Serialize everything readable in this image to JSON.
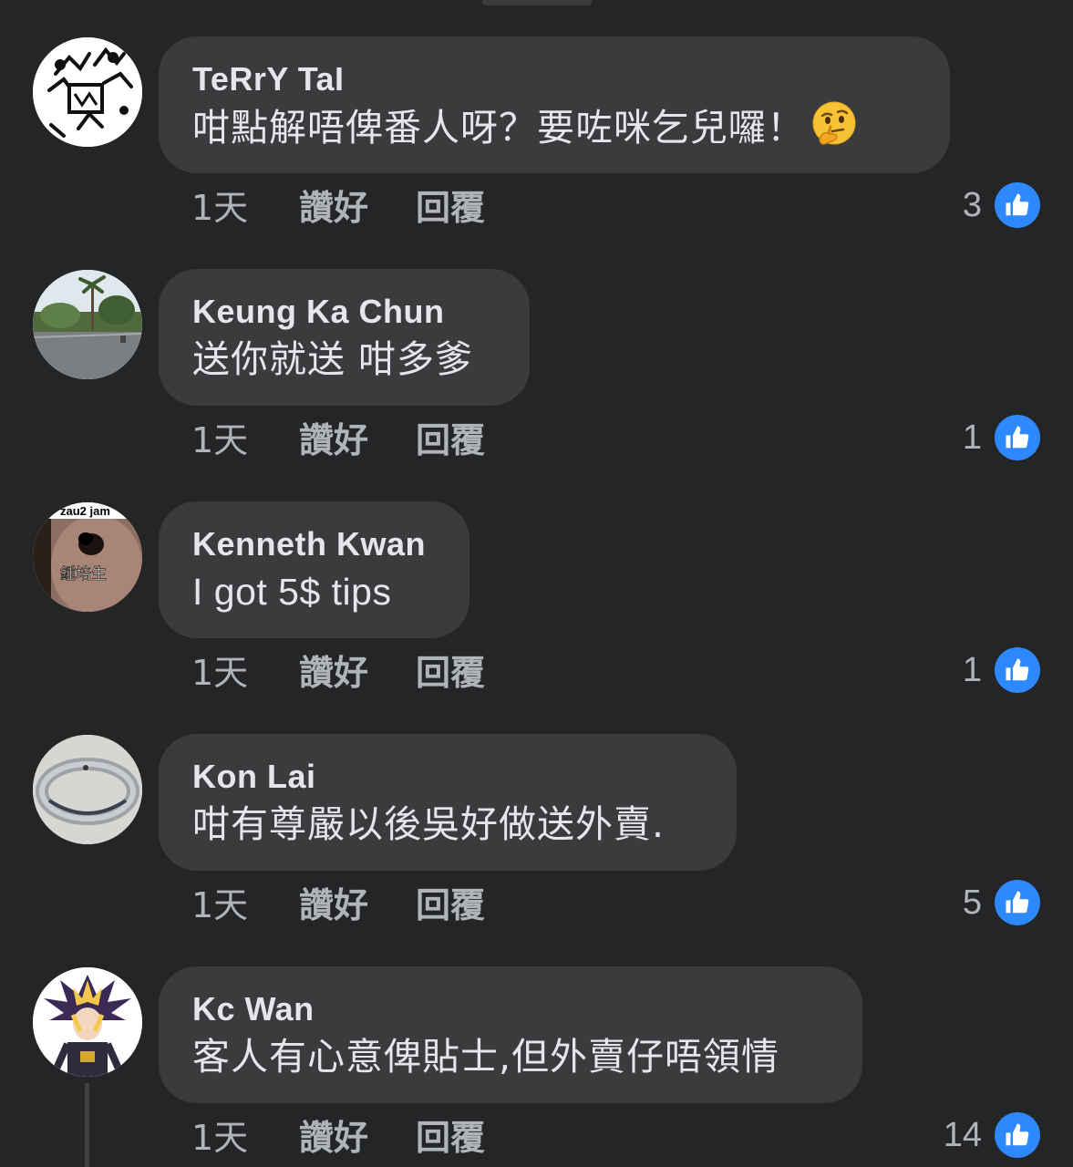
{
  "comments": [
    {
      "author": "TeRrY TaI",
      "text": "咁點解唔俾番人呀？要咗咪乞兒囉！",
      "emoji": "thinking-face",
      "time": "1天",
      "like_label": "讚好",
      "reply_label": "回覆",
      "reaction_count": "3"
    },
    {
      "author": "Keung Ka Chun",
      "text": "送你就送 咁多爹",
      "time": "1天",
      "like_label": "讚好",
      "reply_label": "回覆",
      "reaction_count": "1"
    },
    {
      "author": "Kenneth Kwan",
      "text": "I got 5$ tips",
      "avatar_text": [
        "zau2 jam",
        "鍾培生"
      ],
      "time": "1天",
      "like_label": "讚好",
      "reply_label": "回覆",
      "reaction_count": "1"
    },
    {
      "author": "Kon Lai",
      "text": "咁有尊嚴以後吳好做送外賣.",
      "time": "1天",
      "like_label": "讚好",
      "reply_label": "回覆",
      "reaction_count": "5"
    },
    {
      "author": "Kc Wan",
      "text": "客人有心意俾貼士,但外賣仔唔領情",
      "time": "1天",
      "like_label": "讚好",
      "reply_label": "回覆",
      "reaction_count": "14"
    }
  ],
  "colors": {
    "background": "#242526",
    "bubble": "#3a3b3c",
    "primary_text": "#e4e6eb",
    "secondary_text": "#b0b3b8",
    "like_blue": "#2e89ff"
  }
}
